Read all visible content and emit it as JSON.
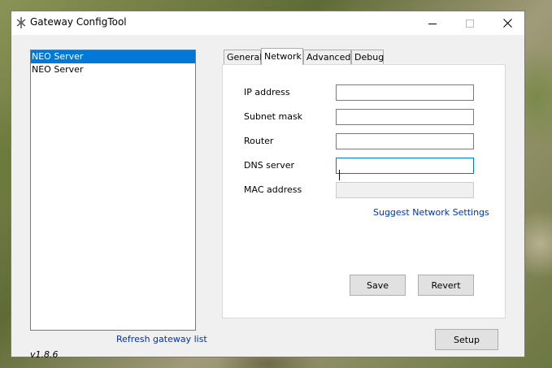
{
  "window": {
    "title": "Gateway ConfigTool"
  },
  "gateway_list": {
    "items": [
      {
        "label": "NEO Server",
        "selected": true
      },
      {
        "label": "NEO Server",
        "selected": false
      }
    ],
    "refresh_label": "Refresh gateway list"
  },
  "version": "v1.8.6",
  "tabs": [
    {
      "label": "General",
      "active": false
    },
    {
      "label": "Network",
      "active": true
    },
    {
      "label": "Advanced",
      "active": false
    },
    {
      "label": "Debug",
      "active": false
    }
  ],
  "network": {
    "ip_address": {
      "label": "IP address",
      "value": ""
    },
    "subnet_mask": {
      "label": "Subnet mask",
      "value": ""
    },
    "router": {
      "label": "Router",
      "value": ""
    },
    "dns_server": {
      "label": "DNS server",
      "value": ""
    },
    "mac_address": {
      "label": "MAC address",
      "value": ""
    },
    "suggest_label": "Suggest Network Settings",
    "save_label": "Save",
    "revert_label": "Revert"
  },
  "setup_label": "Setup"
}
